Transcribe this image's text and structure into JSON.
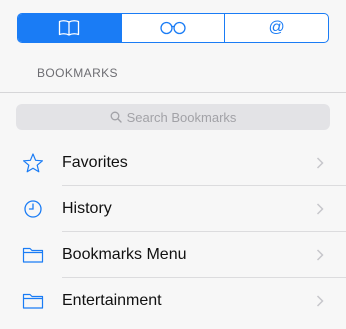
{
  "tabs": [
    {
      "icon": "book-icon",
      "active": true
    },
    {
      "icon": "reading-glasses-icon",
      "active": false
    },
    {
      "icon": "at-sign-icon",
      "label": "@",
      "active": false
    }
  ],
  "section": {
    "title": "BOOKMARKS"
  },
  "search": {
    "placeholder": "Search Bookmarks",
    "icon": "search-icon"
  },
  "items": [
    {
      "label": "Favorites",
      "icon": "star-icon"
    },
    {
      "label": "History",
      "icon": "clock-icon"
    },
    {
      "label": "Bookmarks Menu",
      "icon": "folder-icon"
    },
    {
      "label": "Entertainment",
      "icon": "folder-icon"
    }
  ],
  "colors": {
    "accent": "#1a7cf5",
    "background": "#f7f7f7",
    "text": "#111111",
    "muted": "#6d6d72"
  }
}
